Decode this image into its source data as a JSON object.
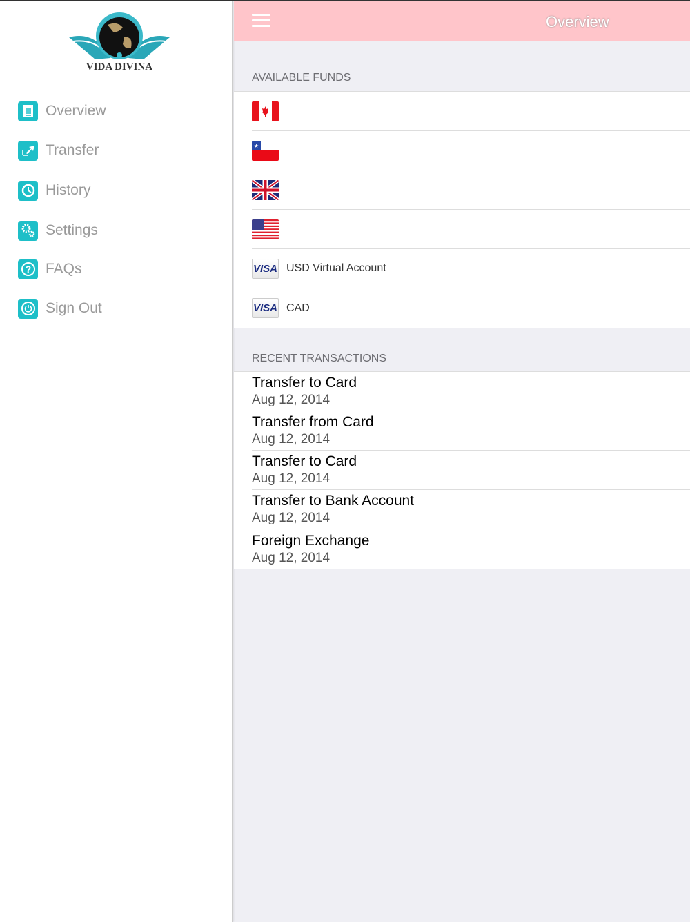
{
  "logo": {
    "text": "VIDA DIVINA"
  },
  "sidebar": {
    "items": [
      {
        "label": "Overview",
        "icon": "document-list-icon"
      },
      {
        "label": "Transfer",
        "icon": "transfer-arrows-icon"
      },
      {
        "label": "History",
        "icon": "history-clock-icon"
      },
      {
        "label": "Settings",
        "icon": "gears-icon"
      },
      {
        "label": "FAQs",
        "icon": "question-icon"
      },
      {
        "label": "Sign Out",
        "icon": "power-icon"
      }
    ]
  },
  "header": {
    "title": "Overview",
    "menu_icon": "hamburger-icon"
  },
  "available_funds": {
    "heading": "AVAILABLE FUNDS",
    "flags": [
      "canada",
      "chile",
      "united-kingdom",
      "united-states"
    ],
    "cards": [
      {
        "brand": "VISA",
        "label": "USD Virtual Account"
      },
      {
        "brand": "VISA",
        "label": "CAD"
      }
    ]
  },
  "recent_transactions": {
    "heading": "RECENT TRANSACTIONS",
    "items": [
      {
        "title": "Transfer to Card",
        "date": "Aug 12, 2014"
      },
      {
        "title": "Transfer from Card",
        "date": "Aug 12, 2014"
      },
      {
        "title": "Transfer to Card",
        "date": "Aug 12, 2014"
      },
      {
        "title": "Transfer to Bank Account",
        "date": "Aug 12, 2014"
      },
      {
        "title": "Foreign Exchange",
        "date": "Aug 12, 2014"
      }
    ]
  },
  "colors": {
    "accent": "#1ebfc8",
    "header": "#ffc5ca",
    "background": "#efeff4"
  }
}
